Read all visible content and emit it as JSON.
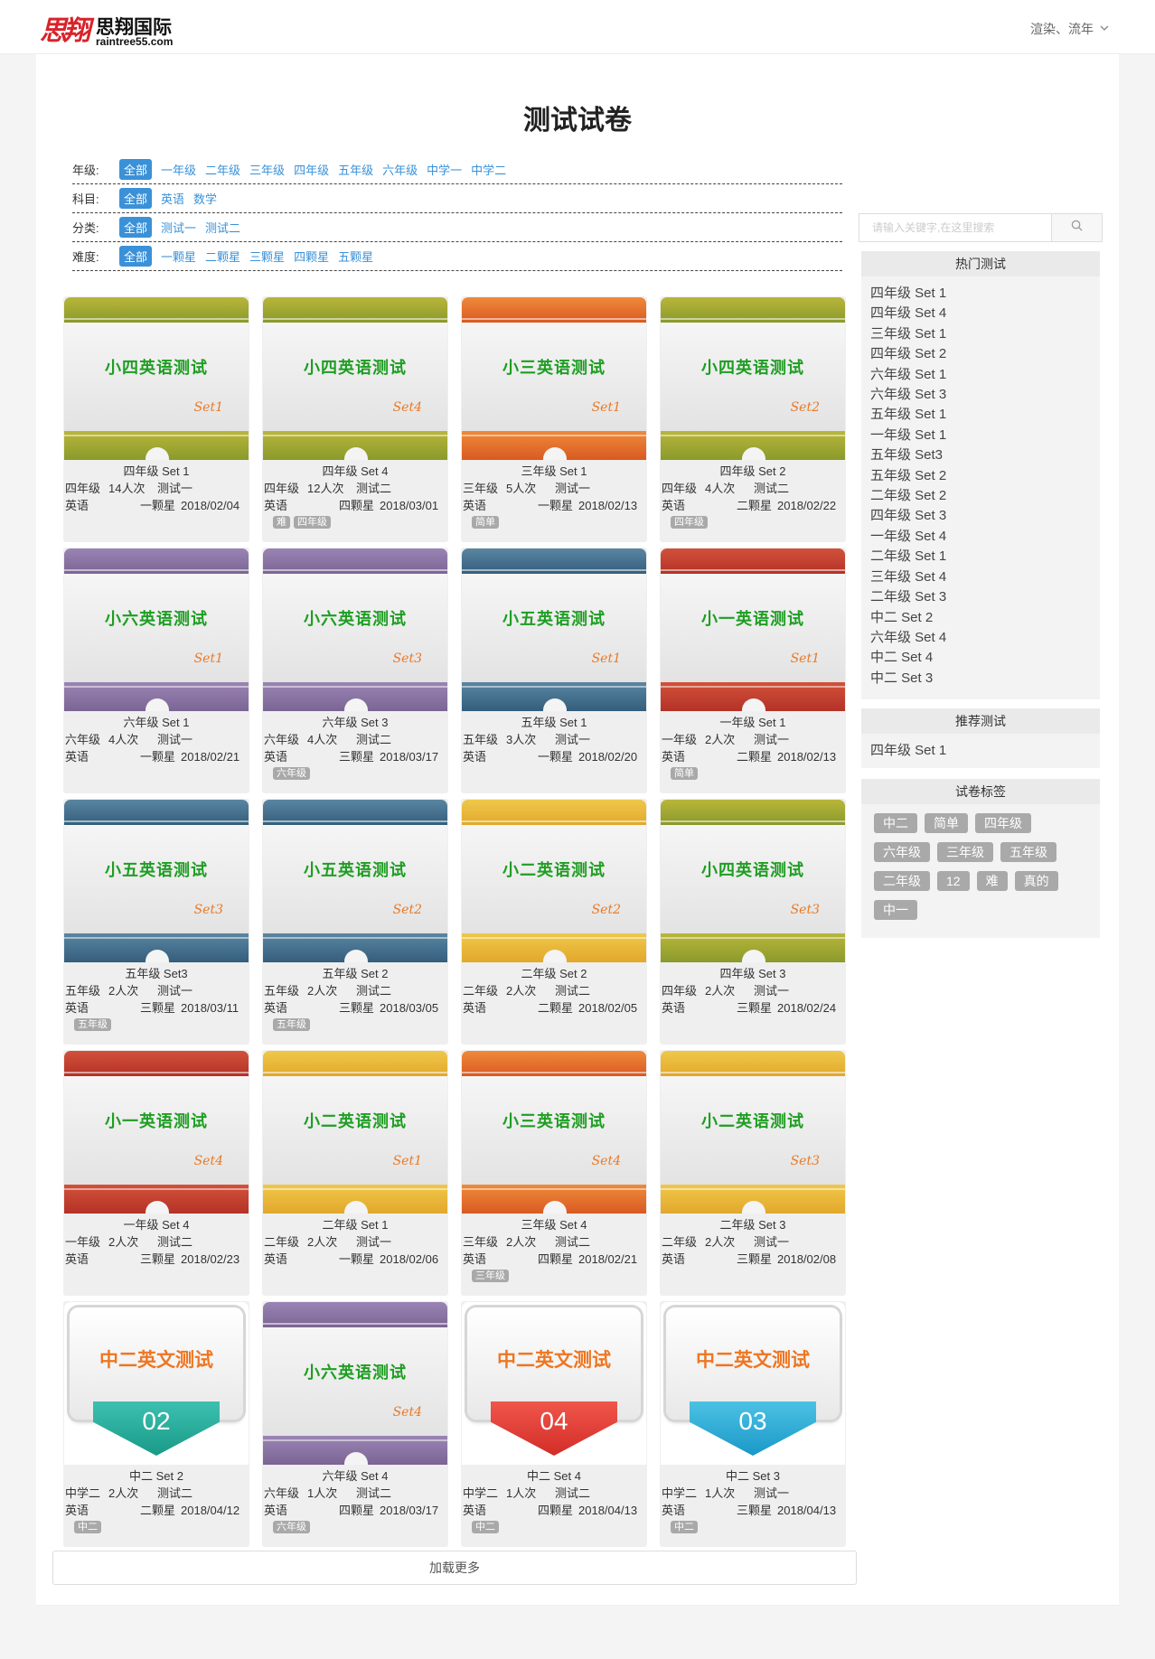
{
  "brand": {
    "logo_mark": "思翔",
    "name_cn": "思翔国际",
    "name_en": "raintree55.com"
  },
  "user": {
    "name": "渲染、流年"
  },
  "page": {
    "title": "测试试卷"
  },
  "filters": [
    {
      "label": "年级:",
      "options": [
        "全部",
        "一年级",
        "二年级",
        "三年级",
        "四年级",
        "五年级",
        "六年级",
        "中学一",
        "中学二"
      ]
    },
    {
      "label": "科目:",
      "options": [
        "全部",
        "英语",
        "数学"
      ]
    },
    {
      "label": "分类:",
      "options": [
        "全部",
        "测试一",
        "测试二"
      ]
    },
    {
      "label": "难度:",
      "options": [
        "全部",
        "一颗星",
        "二颗星",
        "三颗星",
        "四颗星",
        "五颗星"
      ]
    }
  ],
  "cards": [
    {
      "cover_title": "小四英语测试",
      "cover_set": "Set1",
      "theme": "olive",
      "name": "四年级 Set 1",
      "grade": "四年级",
      "count": "14人次",
      "type": "测试一",
      "subject": "英语",
      "stars": "一颗星",
      "date": "2018/02/04",
      "tags": []
    },
    {
      "cover_title": "小四英语测试",
      "cover_set": "Set4",
      "theme": "olive",
      "name": "四年级 Set 4",
      "grade": "四年级",
      "count": "12人次",
      "type": "测试二",
      "subject": "英语",
      "stars": "四颗星",
      "date": "2018/03/01",
      "tags": [
        "难",
        "四年级"
      ]
    },
    {
      "cover_title": "小三英语测试",
      "cover_set": "Set1",
      "theme": "orange",
      "name": "三年级 Set 1",
      "grade": "三年级",
      "count": "5人次",
      "type": "测试一",
      "subject": "英语",
      "stars": "一颗星",
      "date": "2018/02/13",
      "tags": [
        "简单"
      ]
    },
    {
      "cover_title": "小四英语测试",
      "cover_set": "Set2",
      "theme": "olive",
      "name": "四年级 Set 2",
      "grade": "四年级",
      "count": "4人次",
      "type": "测试二",
      "subject": "英语",
      "stars": "二颗星",
      "date": "2018/02/22",
      "tags": [
        "四年级"
      ]
    },
    {
      "cover_title": "小六英语测试",
      "cover_set": "Set1",
      "theme": "purple",
      "name": "六年级 Set 1",
      "grade": "六年级",
      "count": "4人次",
      "type": "测试一",
      "subject": "英语",
      "stars": "一颗星",
      "date": "2018/02/21",
      "tags": []
    },
    {
      "cover_title": "小六英语测试",
      "cover_set": "Set3",
      "theme": "purple",
      "name": "六年级 Set 3",
      "grade": "六年级",
      "count": "4人次",
      "type": "测试二",
      "subject": "英语",
      "stars": "三颗星",
      "date": "2018/03/17",
      "tags": [
        "六年级"
      ]
    },
    {
      "cover_title": "小五英语测试",
      "cover_set": "Set1",
      "theme": "teal",
      "name": "五年级 Set 1",
      "grade": "五年级",
      "count": "3人次",
      "type": "测试一",
      "subject": "英语",
      "stars": "一颗星",
      "date": "2018/02/20",
      "tags": []
    },
    {
      "cover_title": "小一英语测试",
      "cover_set": "Set1",
      "theme": "red",
      "name": "一年级 Set 1",
      "grade": "一年级",
      "count": "2人次",
      "type": "测试一",
      "subject": "英语",
      "stars": "二颗星",
      "date": "2018/02/13",
      "tags": [
        "简单"
      ]
    },
    {
      "cover_title": "小五英语测试",
      "cover_set": "Set3",
      "theme": "teal",
      "name": "五年级 Set3",
      "grade": "五年级",
      "count": "2人次",
      "type": "测试一",
      "subject": "英语",
      "stars": "三颗星",
      "date": "2018/03/11",
      "tags": [
        "五年级"
      ]
    },
    {
      "cover_title": "小五英语测试",
      "cover_set": "Set2",
      "theme": "teal",
      "name": "五年级 Set 2",
      "grade": "五年级",
      "count": "2人次",
      "type": "测试二",
      "subject": "英语",
      "stars": "三颗星",
      "date": "2018/03/05",
      "tags": [
        "五年级"
      ]
    },
    {
      "cover_title": "小二英语测试",
      "cover_set": "Set2",
      "theme": "yellow",
      "name": "二年级 Set 2",
      "grade": "二年级",
      "count": "2人次",
      "type": "测试二",
      "subject": "英语",
      "stars": "二颗星",
      "date": "2018/02/05",
      "tags": []
    },
    {
      "cover_title": "小四英语测试",
      "cover_set": "Set3",
      "theme": "olive",
      "name": "四年级 Set 3",
      "grade": "四年级",
      "count": "2人次",
      "type": "测试一",
      "subject": "英语",
      "stars": "三颗星",
      "date": "2018/02/24",
      "tags": []
    },
    {
      "cover_title": "小一英语测试",
      "cover_set": "Set4",
      "theme": "red",
      "name": "一年级 Set 4",
      "grade": "一年级",
      "count": "2人次",
      "type": "测试二",
      "subject": "英语",
      "stars": "三颗星",
      "date": "2018/02/23",
      "tags": []
    },
    {
      "cover_title": "小二英语测试",
      "cover_set": "Set1",
      "theme": "yellow",
      "name": "二年级 Set 1",
      "grade": "二年级",
      "count": "2人次",
      "type": "测试一",
      "subject": "英语",
      "stars": "一颗星",
      "date": "2018/02/06",
      "tags": []
    },
    {
      "cover_title": "小三英语测试",
      "cover_set": "Set4",
      "theme": "orange",
      "name": "三年级 Set 4",
      "grade": "三年级",
      "count": "2人次",
      "type": "测试二",
      "subject": "英语",
      "stars": "四颗星",
      "date": "2018/02/21",
      "tags": [
        "三年级"
      ]
    },
    {
      "cover_title": "小二英语测试",
      "cover_set": "Set3",
      "theme": "yellow",
      "name": "二年级 Set 3",
      "grade": "二年级",
      "count": "2人次",
      "type": "测试一",
      "subject": "英语",
      "stars": "三颗星",
      "date": "2018/02/08",
      "tags": []
    },
    {
      "cover_title": "中二英文测试",
      "cover_number": "02",
      "style": "ribbon",
      "theme": "teal",
      "name": "中二 Set 2",
      "grade": "中学二",
      "count": "2人次",
      "type": "测试二",
      "subject": "英语",
      "stars": "二颗星",
      "date": "2018/04/12",
      "tags": [
        "中二"
      ]
    },
    {
      "cover_title": "小六英语测试",
      "cover_set": "Set4",
      "theme": "purple",
      "name": "六年级 Set 4",
      "grade": "六年级",
      "count": "1人次",
      "type": "测试二",
      "subject": "英语",
      "stars": "四颗星",
      "date": "2018/03/17",
      "tags": [
        "六年级"
      ]
    },
    {
      "cover_title": "中二英文测试",
      "cover_number": "04",
      "style": "ribbon",
      "theme": "red",
      "name": "中二 Set 4",
      "grade": "中学二",
      "count": "1人次",
      "type": "测试二",
      "subject": "英语",
      "stars": "四颗星",
      "date": "2018/04/13",
      "tags": [
        "中二"
      ]
    },
    {
      "cover_title": "中二英文测试",
      "cover_number": "03",
      "style": "ribbon",
      "theme": "blue",
      "name": "中二 Set 3",
      "grade": "中学二",
      "count": "1人次",
      "type": "测试一",
      "subject": "英语",
      "stars": "三颗星",
      "date": "2018/04/13",
      "tags": [
        "中二"
      ]
    }
  ],
  "load_more": "加载更多",
  "search": {
    "placeholder": "请输入关键字,在这里搜索"
  },
  "sidebar": {
    "hot_title": "热门测试",
    "hot_items": [
      "四年级 Set 1",
      "四年级 Set 4",
      "三年级 Set 1",
      "四年级 Set 2",
      "六年级 Set 1",
      "六年级 Set 3",
      "五年级 Set 1",
      "一年级 Set 1",
      "五年级 Set3",
      "五年级 Set 2",
      "二年级 Set 2",
      "四年级 Set 3",
      "一年级 Set 4",
      "二年级 Set 1",
      "三年级 Set 4",
      "二年级 Set 3",
      "中二 Set 2",
      "六年级 Set 4",
      "中二 Set 4",
      "中二 Set 3"
    ],
    "rec_title": "推荐测试",
    "rec_items": [
      "四年级 Set 1"
    ],
    "tag_title": "试卷标签",
    "tags": [
      "中二",
      "简单",
      "四年级",
      "六年级",
      "三年级",
      "五年级",
      "二年级",
      "12",
      "难",
      "真的",
      "中一"
    ]
  }
}
